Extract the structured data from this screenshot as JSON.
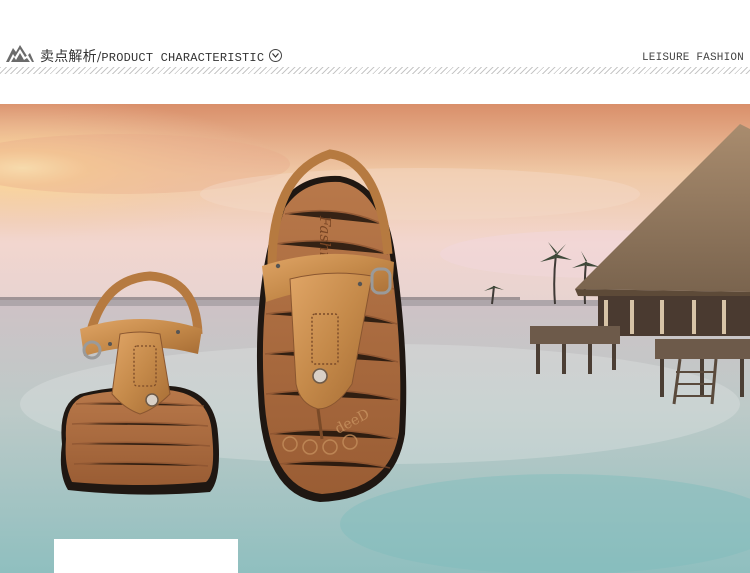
{
  "header": {
    "title_cn": "卖点解析",
    "title_sep": "/",
    "title_en": "PRODUCT CHARACTERISTIC",
    "tagline": "LEISURE FASHION",
    "logo_icon": "mountain-logo-icon",
    "chevron_icon": "chevron-down-icon"
  },
  "photo": {
    "shoe_brand_text": "FashioN",
    "sole_text": "deeD",
    "scene": "beach-hut-sunset"
  },
  "colors": {
    "leather": "#c58a4a",
    "sole": "#2a1e16",
    "sky": "#f3c9b0",
    "sea": "#a9c7c6"
  }
}
